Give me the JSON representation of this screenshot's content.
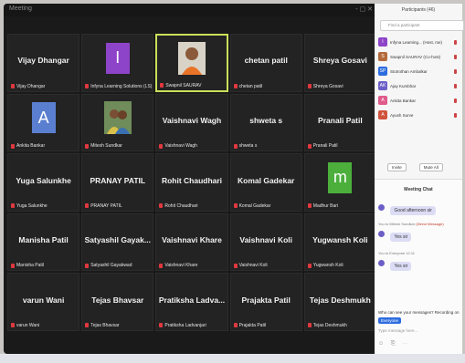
{
  "window": {
    "title": "Meeting",
    "controls": "- ▢ ✕"
  },
  "tiles": [
    {
      "name": "Vijay Dhangar",
      "label": "Vijay Dhangar",
      "type": "name"
    },
    {
      "name": "",
      "label": "Infyna Learning Solutions (LS)",
      "type": "avatar",
      "avatar_letter": "I",
      "avatar_color": "#8e44c8"
    },
    {
      "name": "",
      "label": "Swapnil SAURAV",
      "type": "photo",
      "active": true
    },
    {
      "name": "chetan patil",
      "label": "chetan patil",
      "type": "name"
    },
    {
      "name": "Shreya Gosavi",
      "label": "Shreya Gosavi",
      "type": "name"
    },
    {
      "name": "",
      "label": "Ankita Bankar",
      "type": "avatar",
      "avatar_letter": "A",
      "avatar_color": "#5b7fd0"
    },
    {
      "name": "",
      "label": "Mitesh Sundkar",
      "type": "photo2"
    },
    {
      "name": "Vaishnavi Wagh",
      "label": "Vaishnavi Wagh",
      "type": "name"
    },
    {
      "name": "shweta s",
      "label": "shweta s",
      "type": "name"
    },
    {
      "name": "Pranali Patil",
      "label": "Pranali Patil",
      "type": "name"
    },
    {
      "name": "Yuga Salunkhe",
      "label": "Yuga Salunkhe",
      "type": "name"
    },
    {
      "name": "PRANAY PATIL",
      "label": "PRANAY PATIL",
      "type": "name"
    },
    {
      "name": "Rohit Chaudhari",
      "label": "Rohit Chaudhari",
      "type": "name"
    },
    {
      "name": "Komal Gadekar",
      "label": "Komal Gadekar",
      "type": "name"
    },
    {
      "name": "",
      "label": "Madhur Bari",
      "type": "avatar",
      "avatar_letter": "m",
      "avatar_color": "#4caf3c"
    },
    {
      "name": "Manisha Patil",
      "label": "Manisha Patil",
      "type": "name"
    },
    {
      "name": "Satyashil Gayak...",
      "label": "Satyashil Gayakwad",
      "type": "name"
    },
    {
      "name": "Vaishnavi Khare",
      "label": "Vaishnavi Khare",
      "type": "name"
    },
    {
      "name": "Vaishnavi Koli",
      "label": "Vaishnavi Koli",
      "type": "name"
    },
    {
      "name": "Yugwansh Koli",
      "label": "Yugwansh Koli",
      "type": "name"
    },
    {
      "name": "varun Wani",
      "label": "varun Wani",
      "type": "name"
    },
    {
      "name": "Tejas Bhavsar",
      "label": "Tejas Bhavsar",
      "type": "name"
    },
    {
      "name": "Pratiksha Ladva...",
      "label": "Pratiksha Ladvanjari",
      "type": "name"
    },
    {
      "name": "Prajakta Patil",
      "label": "Prajakta Patil",
      "type": "name"
    },
    {
      "name": "Tejas Deshmukh",
      "label": "Tejas Deshmukh",
      "type": "name"
    }
  ],
  "participants": {
    "title": "Participants (46)",
    "search_placeholder": "Find a participant",
    "list": [
      {
        "initial": "I",
        "color": "#8e44c8",
        "name": "Infyna Learning... (Host, me)"
      },
      {
        "initial": "S",
        "color": "#b46a3c",
        "name": "Swapnil SAURAV (Co-host)"
      },
      {
        "initial": "SP",
        "color": "#2d6cdf",
        "name": "Stotrothan Ambalkar"
      },
      {
        "initial": "AK",
        "color": "#6b5fc7",
        "name": "Ajay Kumbhar"
      },
      {
        "initial": "A",
        "color": "#e05a8a",
        "name": "Ankita Bankar"
      },
      {
        "initial": "A",
        "color": "#d0543c",
        "name": "Ayush Surve"
      }
    ],
    "invite": "Invite",
    "mute_all": "Mute All"
  },
  "chat": {
    "title": "Meeting Chat",
    "messages": [
      {
        "meta": "",
        "meta_hl": "",
        "text": "Good afternoon sir"
      },
      {
        "meta": "You to Mitesh Sundkar",
        "meta_hl": "(Direct Message)",
        "text": "Yes sir"
      },
      {
        "meta": "You to Everyone 12:11",
        "meta_hl": "",
        "text": "Yes sir"
      }
    ],
    "to_label": "Who can see your messages? Recording on",
    "recipient": "Everyone",
    "input_placeholder": "Type message here...",
    "tools": "☺ ⎘ ⋯"
  }
}
